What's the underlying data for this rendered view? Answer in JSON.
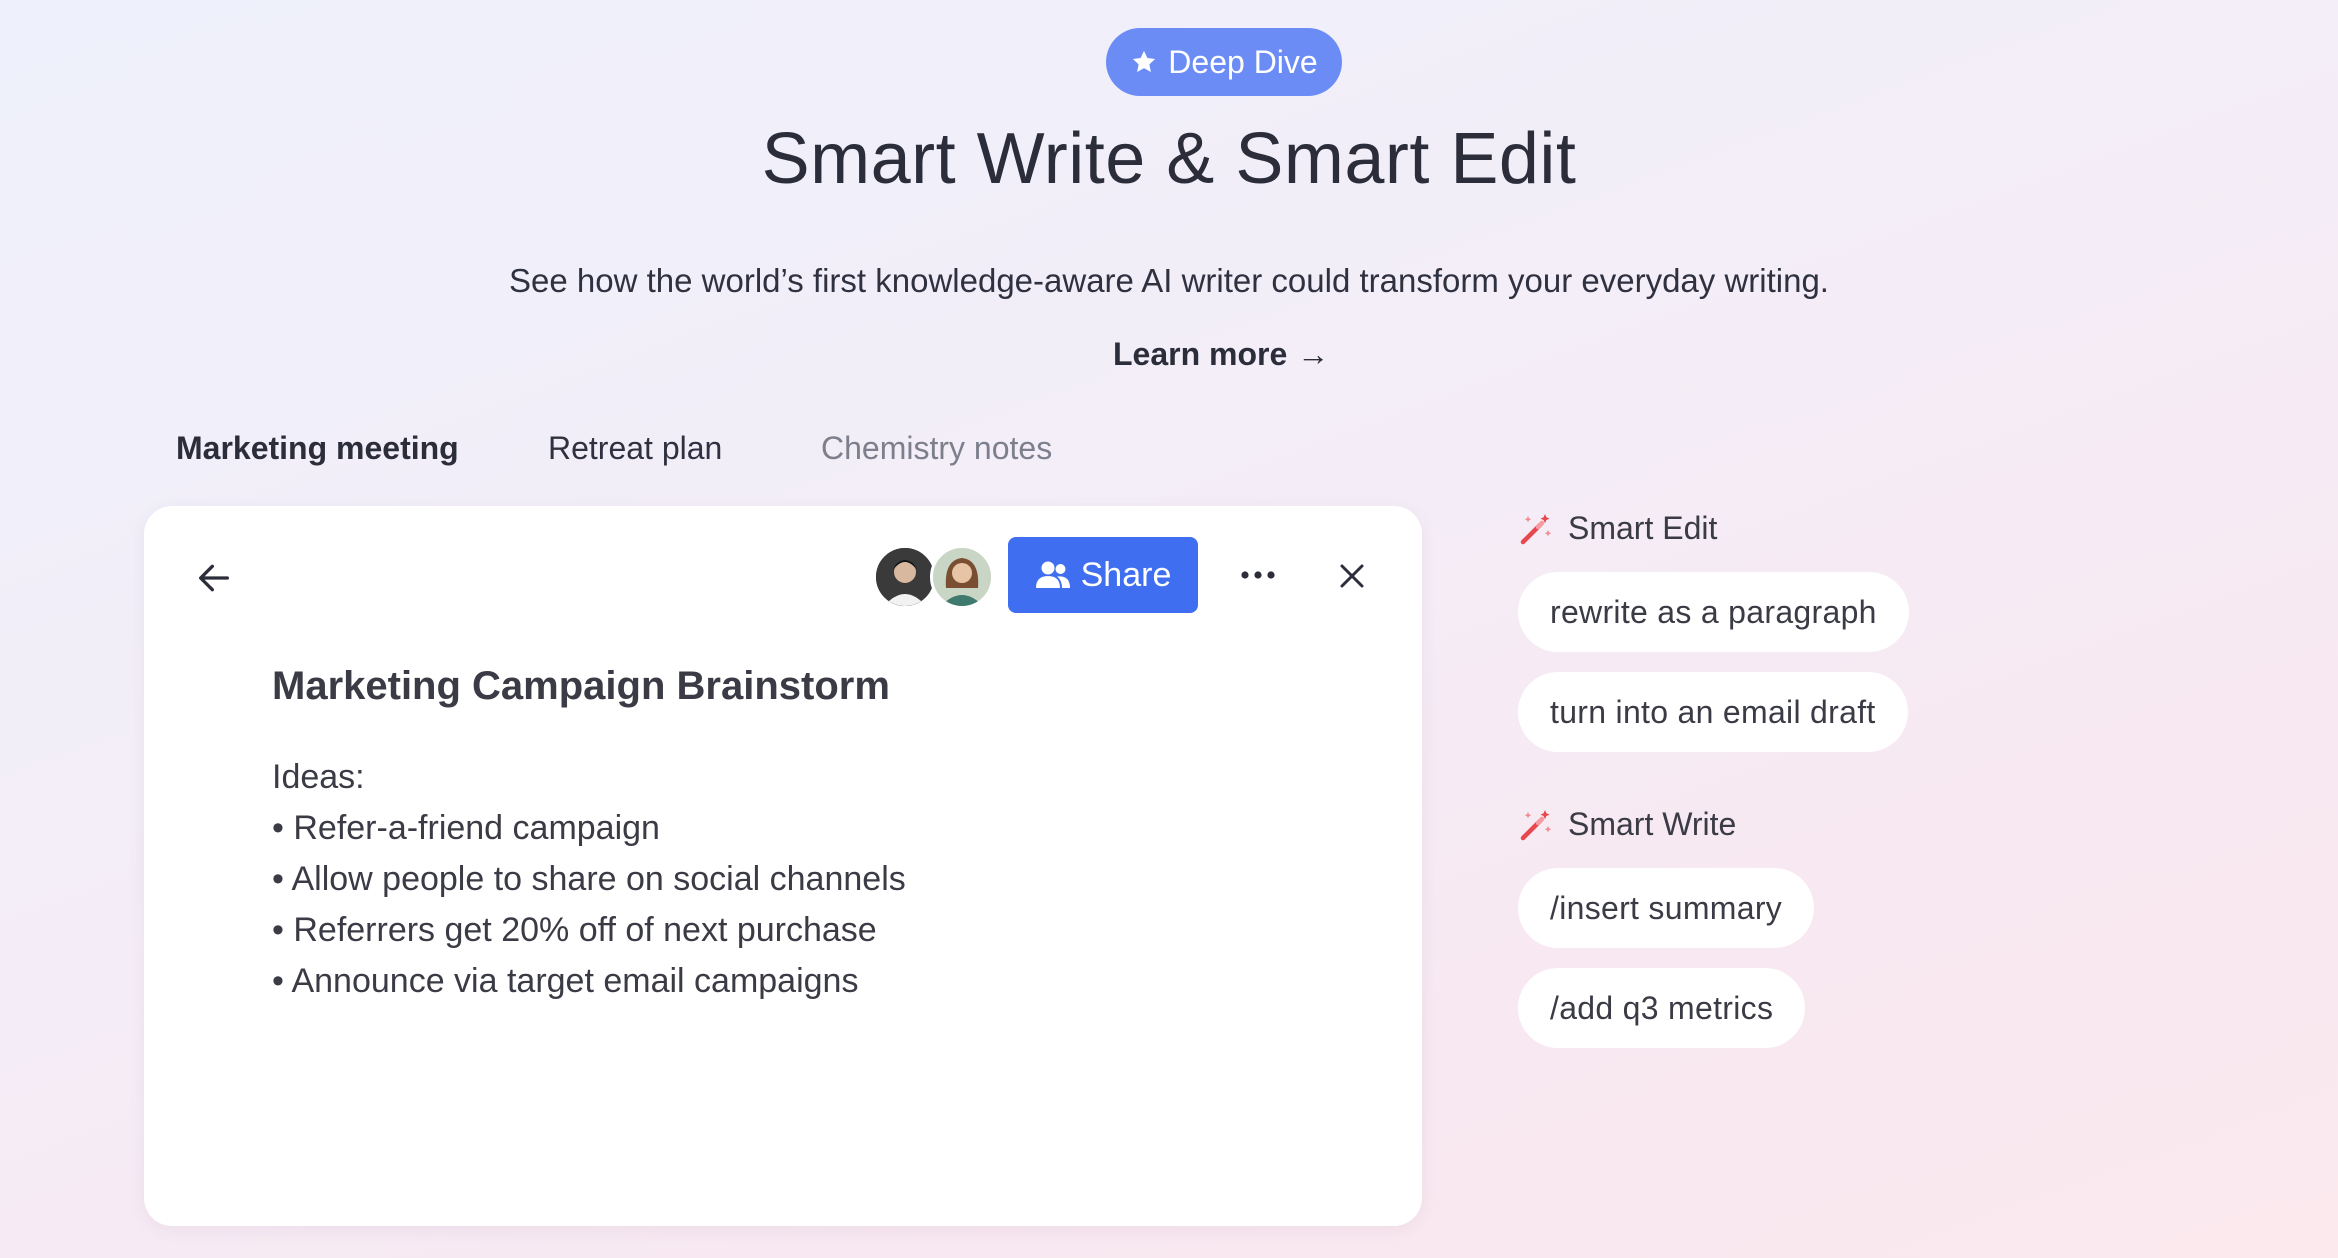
{
  "badge": {
    "label": "Deep Dive",
    "icon": "star-icon",
    "color": "#6b8cf5"
  },
  "hero": {
    "title": "Smart Write & Smart Edit",
    "subtitle": "See how the world’s first knowledge-aware AI writer could transform your everyday writing.",
    "learn_more": "Learn more",
    "learn_more_arrow": "→"
  },
  "tabs": [
    {
      "label": "Marketing meeting",
      "state": "active"
    },
    {
      "label": "Retreat plan",
      "state": "regular"
    },
    {
      "label": "Chemistry notes",
      "state": "muted"
    }
  ],
  "editor": {
    "share_label": "Share",
    "share_color": "#3f6ff0",
    "doc_title": "Marketing Campaign Brainstorm",
    "lines": [
      "Ideas:",
      "• Refer-a-friend campaign",
      "• Allow people to share on social channels",
      "• Referrers get 20% off of next purchase",
      "• Announce via target email campaigns"
    ]
  },
  "smart_edit": {
    "heading": "Smart Edit",
    "chips": [
      "rewrite as a paragraph",
      "turn into an email draft"
    ]
  },
  "smart_write": {
    "heading": "Smart Write",
    "chips": [
      "/insert summary",
      "/add q3 metrics"
    ]
  }
}
